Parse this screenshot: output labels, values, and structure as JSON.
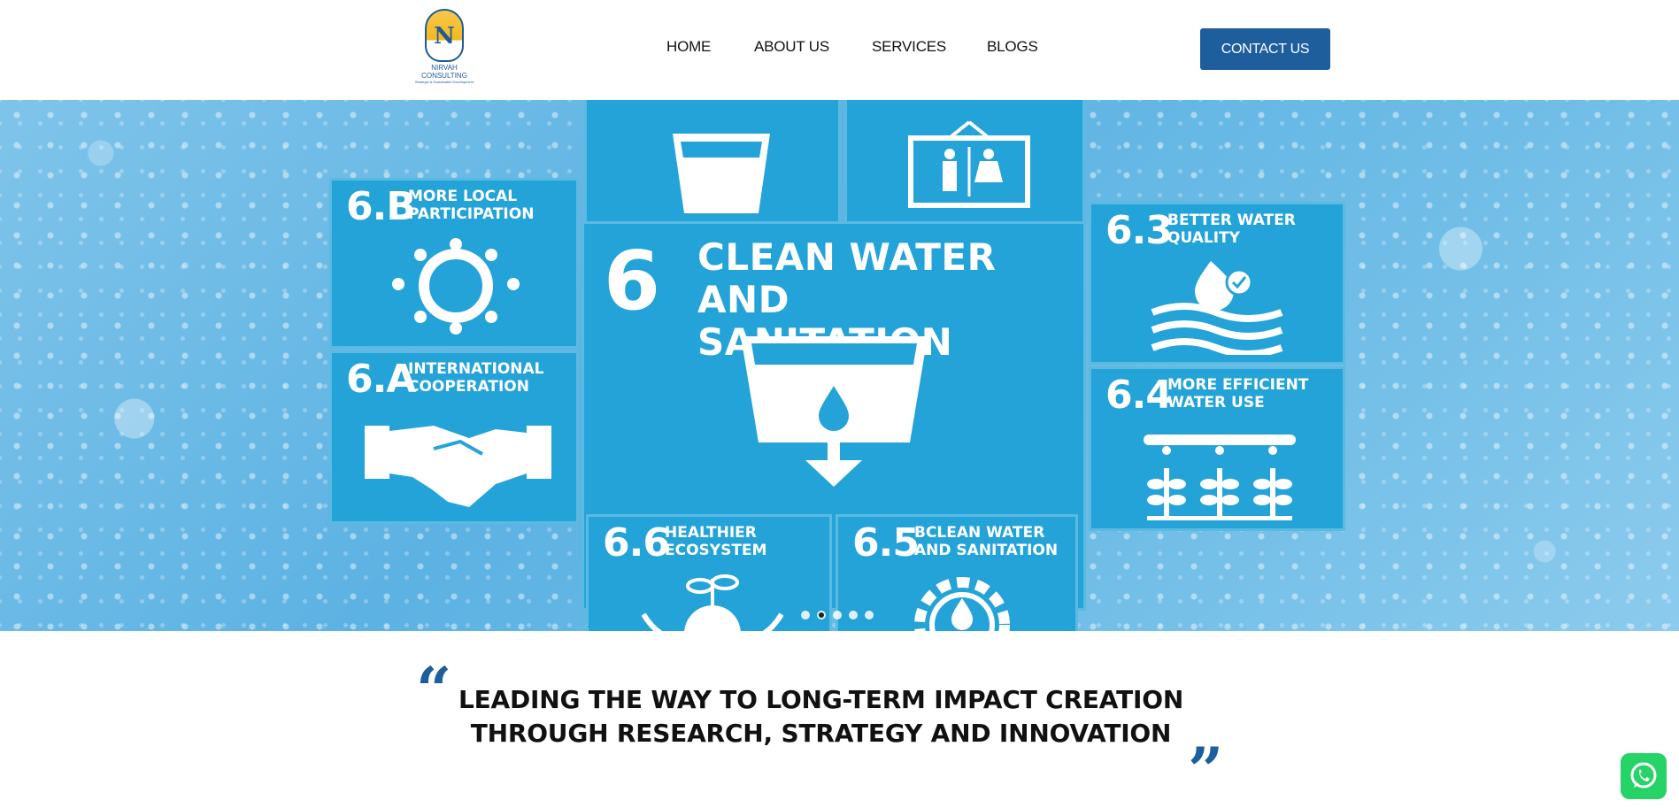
{
  "header": {
    "logo": {
      "name": "NIRVAH CONSULTING",
      "tagline": "Strategic & Sustainable Development",
      "letter": "N"
    },
    "nav": [
      {
        "label": "HOME"
      },
      {
        "label": "ABOUT US"
      },
      {
        "label": "SERVICES"
      },
      {
        "label": "BLOGS"
      }
    ],
    "contact_label": "CONTACT US",
    "accent": "#1f5e9c"
  },
  "hero": {
    "main_tile": {
      "number": "6",
      "title": "CLEAN WATER AND SANITATION"
    },
    "tiles": [
      {
        "number": "6.B",
        "title": "MORE LOCAL PARTICIPATION",
        "icon": "community-circle-icon"
      },
      {
        "number": "6.A",
        "title": "INTERNATIONAL COOPERATION",
        "icon": "handshake-icon"
      },
      {
        "number": "6.3",
        "title": "BETTER WATER QUALITY",
        "icon": "water-waves-icon"
      },
      {
        "number": "6.4",
        "title": "MORE EFFICIENT WATER USE",
        "icon": "irrigation-icon"
      },
      {
        "number": "6.6",
        "title": "HEALTHIER ECOSYSTEM",
        "icon": "plant-globe-icon"
      },
      {
        "number": "6.5",
        "title": "BCLEAN WATER AND SANITATION",
        "icon": "gear-drop-icon"
      }
    ],
    "tile_color": "#24a3d8",
    "slides_total": 5,
    "active_slide": 2
  },
  "quote": {
    "line1": "LEADING THE WAY TO LONG-TERM IMPACT CREATION",
    "line2": "THROUGH RESEARCH, STRATEGY AND INNOVATION",
    "open_mark": "“",
    "close_mark": "”"
  },
  "whatsapp": {
    "icon": "whatsapp-icon",
    "color": "#25d366"
  }
}
